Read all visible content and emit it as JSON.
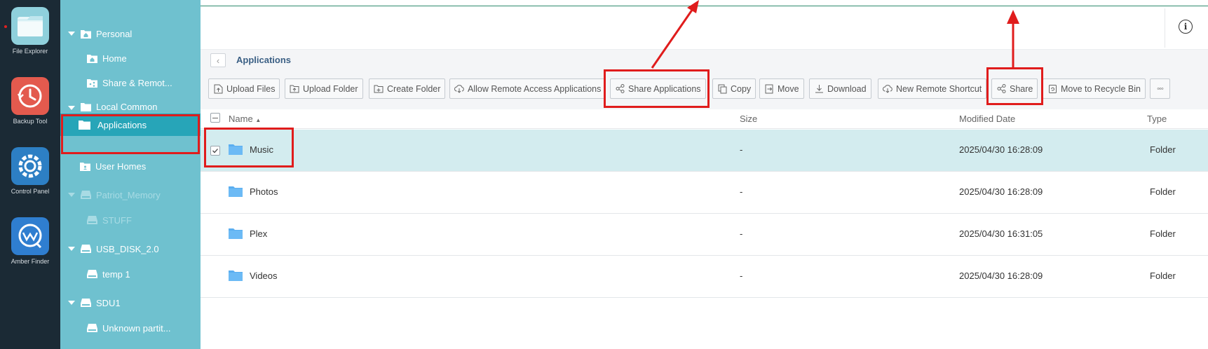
{
  "dock": {
    "apps": [
      {
        "label": "File Explorer",
        "icon": "folder-app-icon"
      },
      {
        "label": "Backup Tool",
        "icon": "clock-app-icon"
      },
      {
        "label": "Control Panel",
        "icon": "gear-app-icon"
      },
      {
        "label": "Amber Finder",
        "icon": "finder-app-icon"
      }
    ]
  },
  "sidebar": {
    "items": [
      {
        "label": "Personal"
      },
      {
        "label": "Home"
      },
      {
        "label": "Share & Remot..."
      },
      {
        "label": "Local Common"
      },
      {
        "label": "Applications"
      },
      {
        "label": "User Homes"
      },
      {
        "label": "Patriot_Memory"
      },
      {
        "label": "STUFF"
      },
      {
        "label": "USB_DISK_2.0"
      },
      {
        "label": "temp 1"
      },
      {
        "label": "SDU1"
      },
      {
        "label": "Unknown partit..."
      }
    ]
  },
  "path": {
    "title": "Applications"
  },
  "toolbar": {
    "buttons": [
      {
        "label": "Upload Files"
      },
      {
        "label": "Upload Folder"
      },
      {
        "label": "Create Folder"
      },
      {
        "label": "Allow Remote Access Applications"
      },
      {
        "label": "Share Applications"
      },
      {
        "label": "Copy"
      },
      {
        "label": "Move"
      },
      {
        "label": "Download"
      },
      {
        "label": "New Remote Shortcut"
      },
      {
        "label": "Share"
      },
      {
        "label": "Move to Recycle Bin"
      },
      {
        "label": "◦◦◦"
      }
    ]
  },
  "table": {
    "columns": {
      "name": "Name",
      "size": "Size",
      "modified": "Modified Date",
      "type": "Type"
    },
    "rows": [
      {
        "name": "Music",
        "size": "-",
        "modified": "2025/04/30 16:28:09",
        "type": "Folder",
        "selected": true
      },
      {
        "name": "Photos",
        "size": "-",
        "modified": "2025/04/30 16:28:09",
        "type": "Folder",
        "selected": false
      },
      {
        "name": "Plex",
        "size": "-",
        "modified": "2025/04/30 16:31:05",
        "type": "Folder",
        "selected": false
      },
      {
        "name": "Videos",
        "size": "-",
        "modified": "2025/04/30 16:28:09",
        "type": "Folder",
        "selected": false
      }
    ]
  },
  "colors": {
    "sidebar": "#6fc1cf",
    "sidebar_selected": "#27a5b8",
    "dock": "#1b2a35",
    "row_selected": "#d3ecef",
    "annotation": "#e01c1c",
    "folder": "#5aaef0"
  }
}
